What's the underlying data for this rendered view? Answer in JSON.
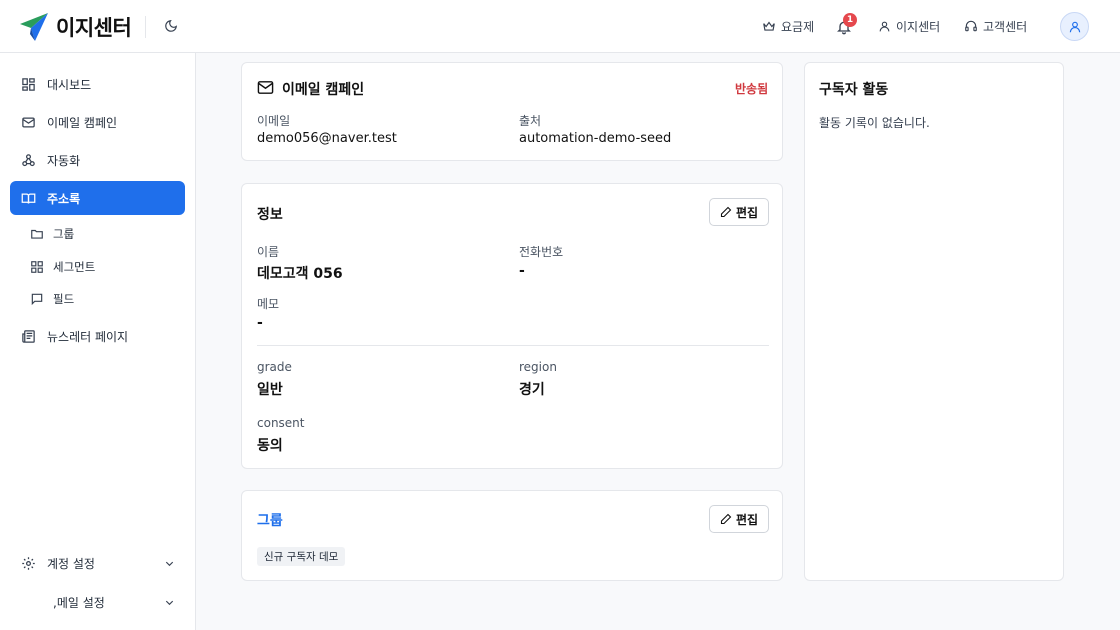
{
  "header": {
    "brand": "이지센터",
    "pricing_label": "요금제",
    "notification_count": "1",
    "account_label": "이지센터",
    "support_label": "고객센터"
  },
  "sidebar": {
    "items": [
      {
        "label": "대시보드",
        "icon": "dashboard-icon"
      },
      {
        "label": "이메일 캠페인",
        "icon": "mail-icon"
      },
      {
        "label": "자동화",
        "icon": "webhook-icon"
      },
      {
        "label": "주소록",
        "icon": "book-icon",
        "active": true
      }
    ],
    "sub_items": [
      {
        "label": "그룹",
        "icon": "folder-icon"
      },
      {
        "label": "세그먼트",
        "icon": "grid-icon"
      },
      {
        "label": "필드",
        "icon": "message-icon"
      }
    ],
    "newsletter_label": "뉴스레터 페이지",
    "account_settings_label": "계정 설정",
    "email_settings_label": ",메일 설정"
  },
  "campaign_card": {
    "title": "이메일 캠페인",
    "status": "반송됨",
    "email_label": "이메일",
    "email_value": "demo056@naver.test",
    "source_label": "출처",
    "source_value": "automation-demo-seed"
  },
  "info_card": {
    "title": "정보",
    "edit_label": "편집",
    "name_label": "이름",
    "name_value": "데모고객 056",
    "phone_label": "전화번호",
    "phone_value": "-",
    "memo_label": "메모",
    "memo_value": "-",
    "grade_label": "grade",
    "grade_value": "일반",
    "region_label": "region",
    "region_value": "경기",
    "consent_label": "consent",
    "consent_value": "동의"
  },
  "group_card": {
    "title": "그룹",
    "edit_label": "편집",
    "tags": [
      "신규 구독자 데모"
    ]
  },
  "activity_card": {
    "title": "구독자 활동",
    "empty_text": "활동 기록이 없습니다."
  },
  "colors": {
    "accent": "#1f6feb",
    "status_bounced": "#d0383e",
    "group_title": "#1f6feb",
    "notification_badge": "#e5484d"
  }
}
